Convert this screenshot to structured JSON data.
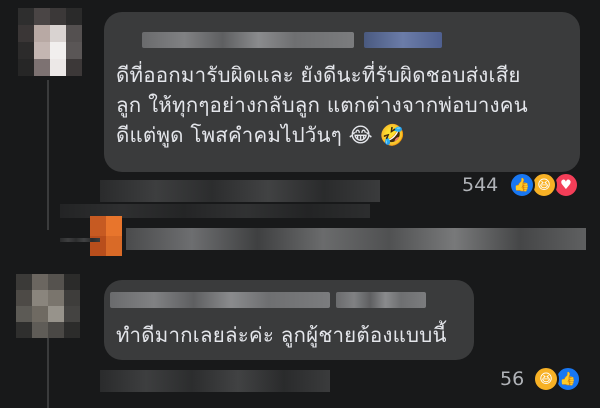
{
  "comments": [
    {
      "text": "ดีที่ออกมารับผิดและ ยังดีนะที่รับผิดชอบส่งเสีย\nลูก ให้ทุกๆอย่างกลับลูก แตกต่างจากพ่อบางคน\nดีแต่พูด โพสคำคมไปวันๆ 😂 🤣",
      "reaction_count": "544",
      "reactions": [
        "like-icon",
        "haha-icon",
        "love-icon"
      ]
    },
    {
      "text": "ทำดีมากเลยล่ะค่ะ ลูกผู้ชายต้องแบบนี้",
      "reaction_count": "56",
      "reactions": [
        "haha-icon",
        "like-icon"
      ]
    }
  ],
  "colors": {
    "background": "#18191a",
    "bubble": "#3a3b3c",
    "text": "#e4e6eb",
    "muted": "#b0b3b8",
    "like": "#1877f2",
    "haha": "#f7b125",
    "love": "#f33e58"
  }
}
